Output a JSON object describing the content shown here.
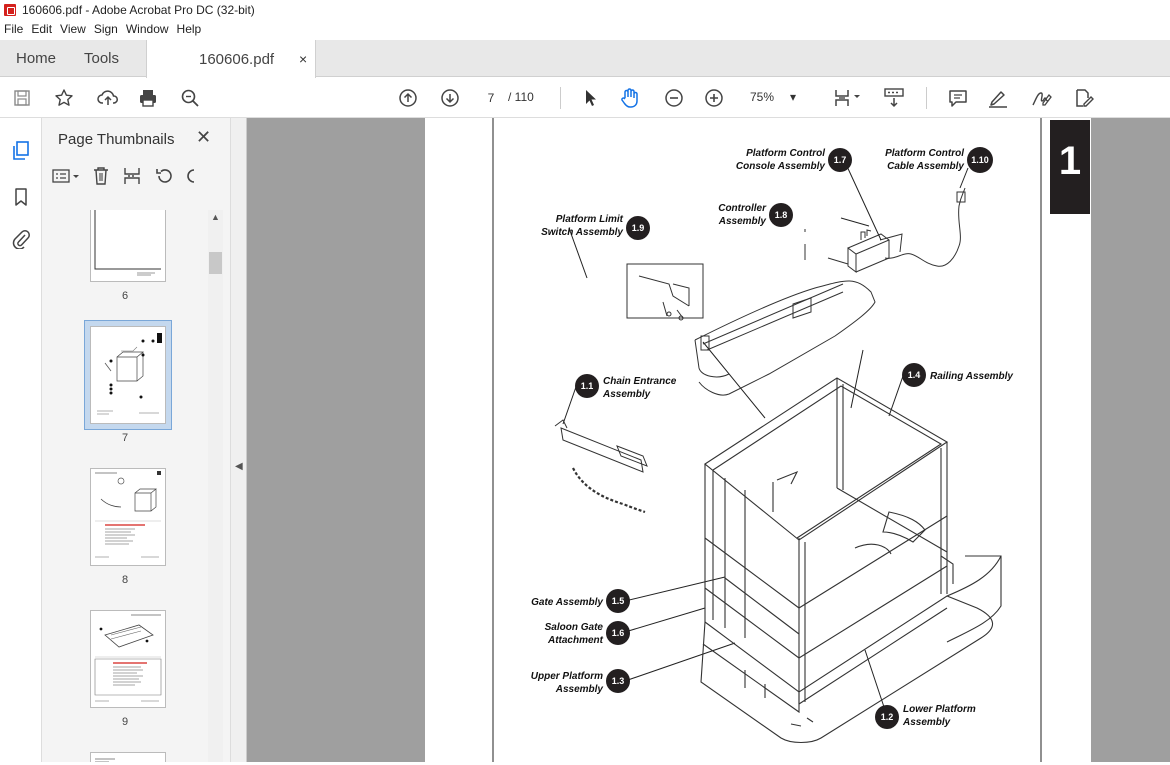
{
  "window": {
    "title": "160606.pdf - Adobe Acrobat Pro DC (32-bit)"
  },
  "menu": [
    "File",
    "Edit",
    "View",
    "Sign",
    "Window",
    "Help"
  ],
  "tabs": {
    "home": "Home",
    "tools": "Tools",
    "document": "160606.pdf",
    "close": "×"
  },
  "toolbar": {
    "current_page": "7",
    "page_total": "/ 110",
    "zoom": "75%",
    "zoom_arrow": "▾"
  },
  "panel": {
    "title": "Page Thumbnails",
    "close": "✕"
  },
  "thumbnails": [
    {
      "label": "6",
      "selected": false
    },
    {
      "label": "7",
      "selected": true
    },
    {
      "label": "8",
      "selected": false
    },
    {
      "label": "9",
      "selected": false
    }
  ],
  "diagram": {
    "section_tab": "1",
    "callouts": [
      {
        "num": "1.7",
        "text1": "Platform Control",
        "text2": "Console Assembly"
      },
      {
        "num": "1.10",
        "text1": "Platform Control",
        "text2": "Cable Assembly"
      },
      {
        "num": "1.8",
        "text1": "Controller",
        "text2": "Assembly"
      },
      {
        "num": "1.9",
        "text1": "Platform Limit",
        "text2": "Switch Assembly"
      },
      {
        "num": "1.4",
        "text1": "Railing Assembly",
        "text2": ""
      },
      {
        "num": "1.1",
        "text1": "Chain Entrance",
        "text2": "Assembly"
      },
      {
        "num": "1.5",
        "text1": "Gate Assembly",
        "text2": ""
      },
      {
        "num": "1.6",
        "text1": "Saloon Gate",
        "text2": "Attachment"
      },
      {
        "num": "1.3",
        "text1": "Upper Platform",
        "text2": "Assembly"
      },
      {
        "num": "1.2",
        "text1": "Lower Platform",
        "text2": "Assembly"
      }
    ]
  },
  "colors": {
    "accent": "#d4201c",
    "selected_thumb": "#c4d8ee",
    "tab_bg": "#e8e8e8",
    "doc_bg": "#9f9f9f"
  }
}
